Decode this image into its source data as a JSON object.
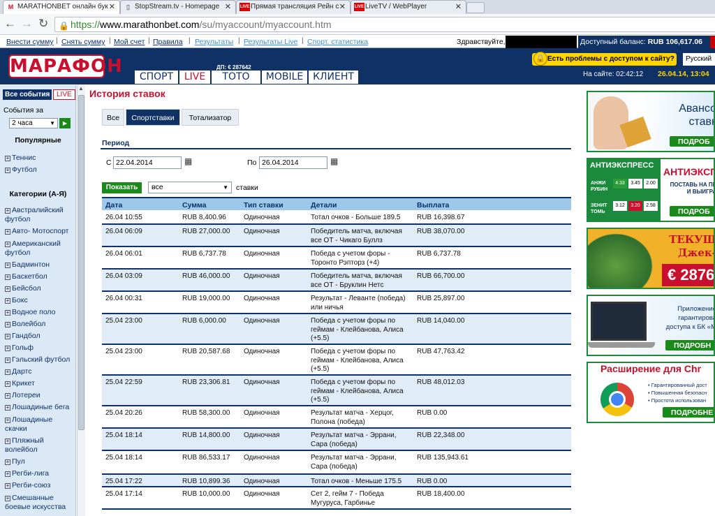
{
  "browser": {
    "tabs": [
      {
        "title": "MARATHONBET онлайн бук",
        "favicon": "M"
      },
      {
        "title": "StopStream.tv - Homepage",
        "favicon": "page-icon"
      },
      {
        "title": "Прямая трансляция Рейн с",
        "favicon": "LIVE"
      },
      {
        "title": "LiveTV / WebPlayer",
        "favicon": "LIVE"
      }
    ],
    "url_scheme": "https://",
    "url_host": "www.marathonbet.com",
    "url_path": "/su/myaccount/myaccount.htm"
  },
  "topnav": {
    "links": [
      "Внести сумму",
      "Снять сумму",
      "Мой счет",
      "Правила"
    ],
    "alt_links": [
      "Результаты",
      "Результаты Live",
      "Спорт. статистика"
    ],
    "greeting": "Здравствуйте,",
    "balance_label": "Доступный баланс:",
    "balance_value": "RUB 106,617.06"
  },
  "header": {
    "logo": "МАРАФОН",
    "dp": "ДП: € 287642",
    "nav": [
      "СПОРТ",
      "LIVE",
      "ТОТО",
      "MOBILE",
      "КЛИЕНТ"
    ],
    "problem": "Есть проблемы с доступом к сайту?",
    "language": "Русский",
    "online": "На сайте: 02:42:12",
    "datetime": "26.04.14, 13:04"
  },
  "sidebar": {
    "all_events": "Все события",
    "live": "LIVE",
    "events_for": "События за",
    "hours": "2 часа",
    "go": "▶",
    "popular": "Популярные",
    "popular_items": [
      "Теннис",
      "Футбол"
    ],
    "categories_title": "Категории (А-Я)",
    "categories": [
      "Австралийский футбол",
      "Авто- Мотоспорт",
      "Американский футбол",
      "Бадминтон",
      "Баскетбол",
      "Бейсбол",
      "Бокс",
      "Водное поло",
      "Волейбол",
      "Гандбол",
      "Гольф",
      "Гэльский футбол",
      "Дартс",
      "Крикет",
      "Лотереи",
      "Лошадиные бега",
      "Лошадиные скачки",
      "Пляжный волейбол",
      "Пул",
      "Регби-лига",
      "Регби-союз",
      "Смешанные боевые искусства"
    ]
  },
  "content": {
    "title": "История ставок",
    "filter_tabs": [
      "Все",
      "Спортставки",
      "Тотализатор"
    ],
    "period": "Период",
    "from_label": "С",
    "from_value": "22.04.2014",
    "to_label": "По",
    "to_value": "26.04.2014",
    "show": "Показать",
    "type_value": "все",
    "bets_word": "ставки",
    "columns": [
      "Дата",
      "Сумма",
      "Тип ставки",
      "Детали",
      "Выплата"
    ],
    "rows": [
      {
        "date": "26.04 10:55",
        "sum": "RUB 8,400.96",
        "type": "Одиночная",
        "details": "Тотал очков - Больше 189.5",
        "payout": "RUB 16,398.67"
      },
      {
        "date": "26.04 06:09",
        "sum": "RUB 27,000.00",
        "type": "Одиночная",
        "details": "Победитель матча, включая все ОТ - Чикаго Буллз",
        "payout": "RUB 38,070.00"
      },
      {
        "date": "26.04 06:01",
        "sum": "RUB 6,737.78",
        "type": "Одиночная",
        "details": "Победа с учетом форы - Торонто Рэпторз (+4)",
        "payout": "RUB 6,737.78"
      },
      {
        "date": "26.04 03:09",
        "sum": "RUB 46,000.00",
        "type": "Одиночная",
        "details": "Победитель матча, включая все ОТ - Бруклин Нетс",
        "payout": "RUB 66,700.00"
      },
      {
        "date": "26.04 00:31",
        "sum": "RUB 19,000.00",
        "type": "Одиночная",
        "details": "Результат - Леванте (победа) или ничья",
        "payout": "RUB 25,897.00"
      },
      {
        "date": "25.04 23:00",
        "sum": "RUB 6,000.00",
        "type": "Одиночная",
        "details": "Победа с учетом форы по геймам - Клейбанова, Алиса (+5.5)",
        "payout": "RUB 14,040.00"
      },
      {
        "date": "25.04 23:00",
        "sum": "RUB 20,587.68",
        "type": "Одиночная",
        "details": "Победа с учетом форы по геймам - Клейбанова, Алиса (+5.5)",
        "payout": "RUB 47,763.42"
      },
      {
        "date": "25.04 22:59",
        "sum": "RUB 23,306.81",
        "type": "Одиночная",
        "details": "Победа с учетом форы по геймам - Клейбанова, Алиса (+5.5)",
        "payout": "RUB 48,012.03"
      },
      {
        "date": "25.04 20:26",
        "sum": "RUB 58,300.00",
        "type": "Одиночная",
        "details": "Результат матча - Херцог, Полона (победа)",
        "payout": "RUB 0.00"
      },
      {
        "date": "25.04 18:14",
        "sum": "RUB 14,800.00",
        "type": "Одиночная",
        "details": "Результат матча - Эррани, Сара (победа)",
        "payout": "RUB 22,348.00"
      },
      {
        "date": "25.04 18:14",
        "sum": "RUB 86,533.17",
        "type": "Одиночная",
        "details": "Результат матча - Эррани, Сара (победа)",
        "payout": "RUB 135,943.61"
      },
      {
        "date": "25.04 17:22",
        "sum": "RUB 10,899.36",
        "type": "Одиночная",
        "details": "Тотал очков - Меньше 175.5",
        "payout": "RUB 0.00"
      },
      {
        "date": "25.04 17:14",
        "sum": "RUB 10,000.00",
        "type": "Одиночная",
        "details": "Сет 2, гейм 7 - Победа Мугуруса, Гарбинье",
        "payout": "RUB 18,400.00"
      }
    ]
  },
  "ads": [
    {
      "title": "Авансо ставк",
      "button": "ПОДРОБ"
    },
    {
      "title": "АНТИЭКСП",
      "subtitle": "ПОСТАВЬ НА ПР И ВЫИГРА",
      "header": "АНТИЭКСПРЕСС",
      "team1": "АНЖИ РУБИН",
      "team2": "ЗЕНИТ ТОМЬ",
      "odds1": [
        "4.33",
        "3.45",
        "2.00"
      ],
      "odds2": [
        "3.12",
        "3.20",
        "2.58"
      ],
      "button": "ПОДРОБ"
    },
    {
      "title": "ТЕКУЩ Джек-",
      "amount": "€ 2876",
      "button": ""
    },
    {
      "title": "Приложение гарантирова доступа к БК «М",
      "button": "ПОДРОБН"
    },
    {
      "title": "Расширение для Chr",
      "bullets": [
        "• Гарантированный дост",
        "• Повышенная безопасн",
        "• Простота использован"
      ],
      "button": "ПОДРОБНЕ"
    }
  ]
}
